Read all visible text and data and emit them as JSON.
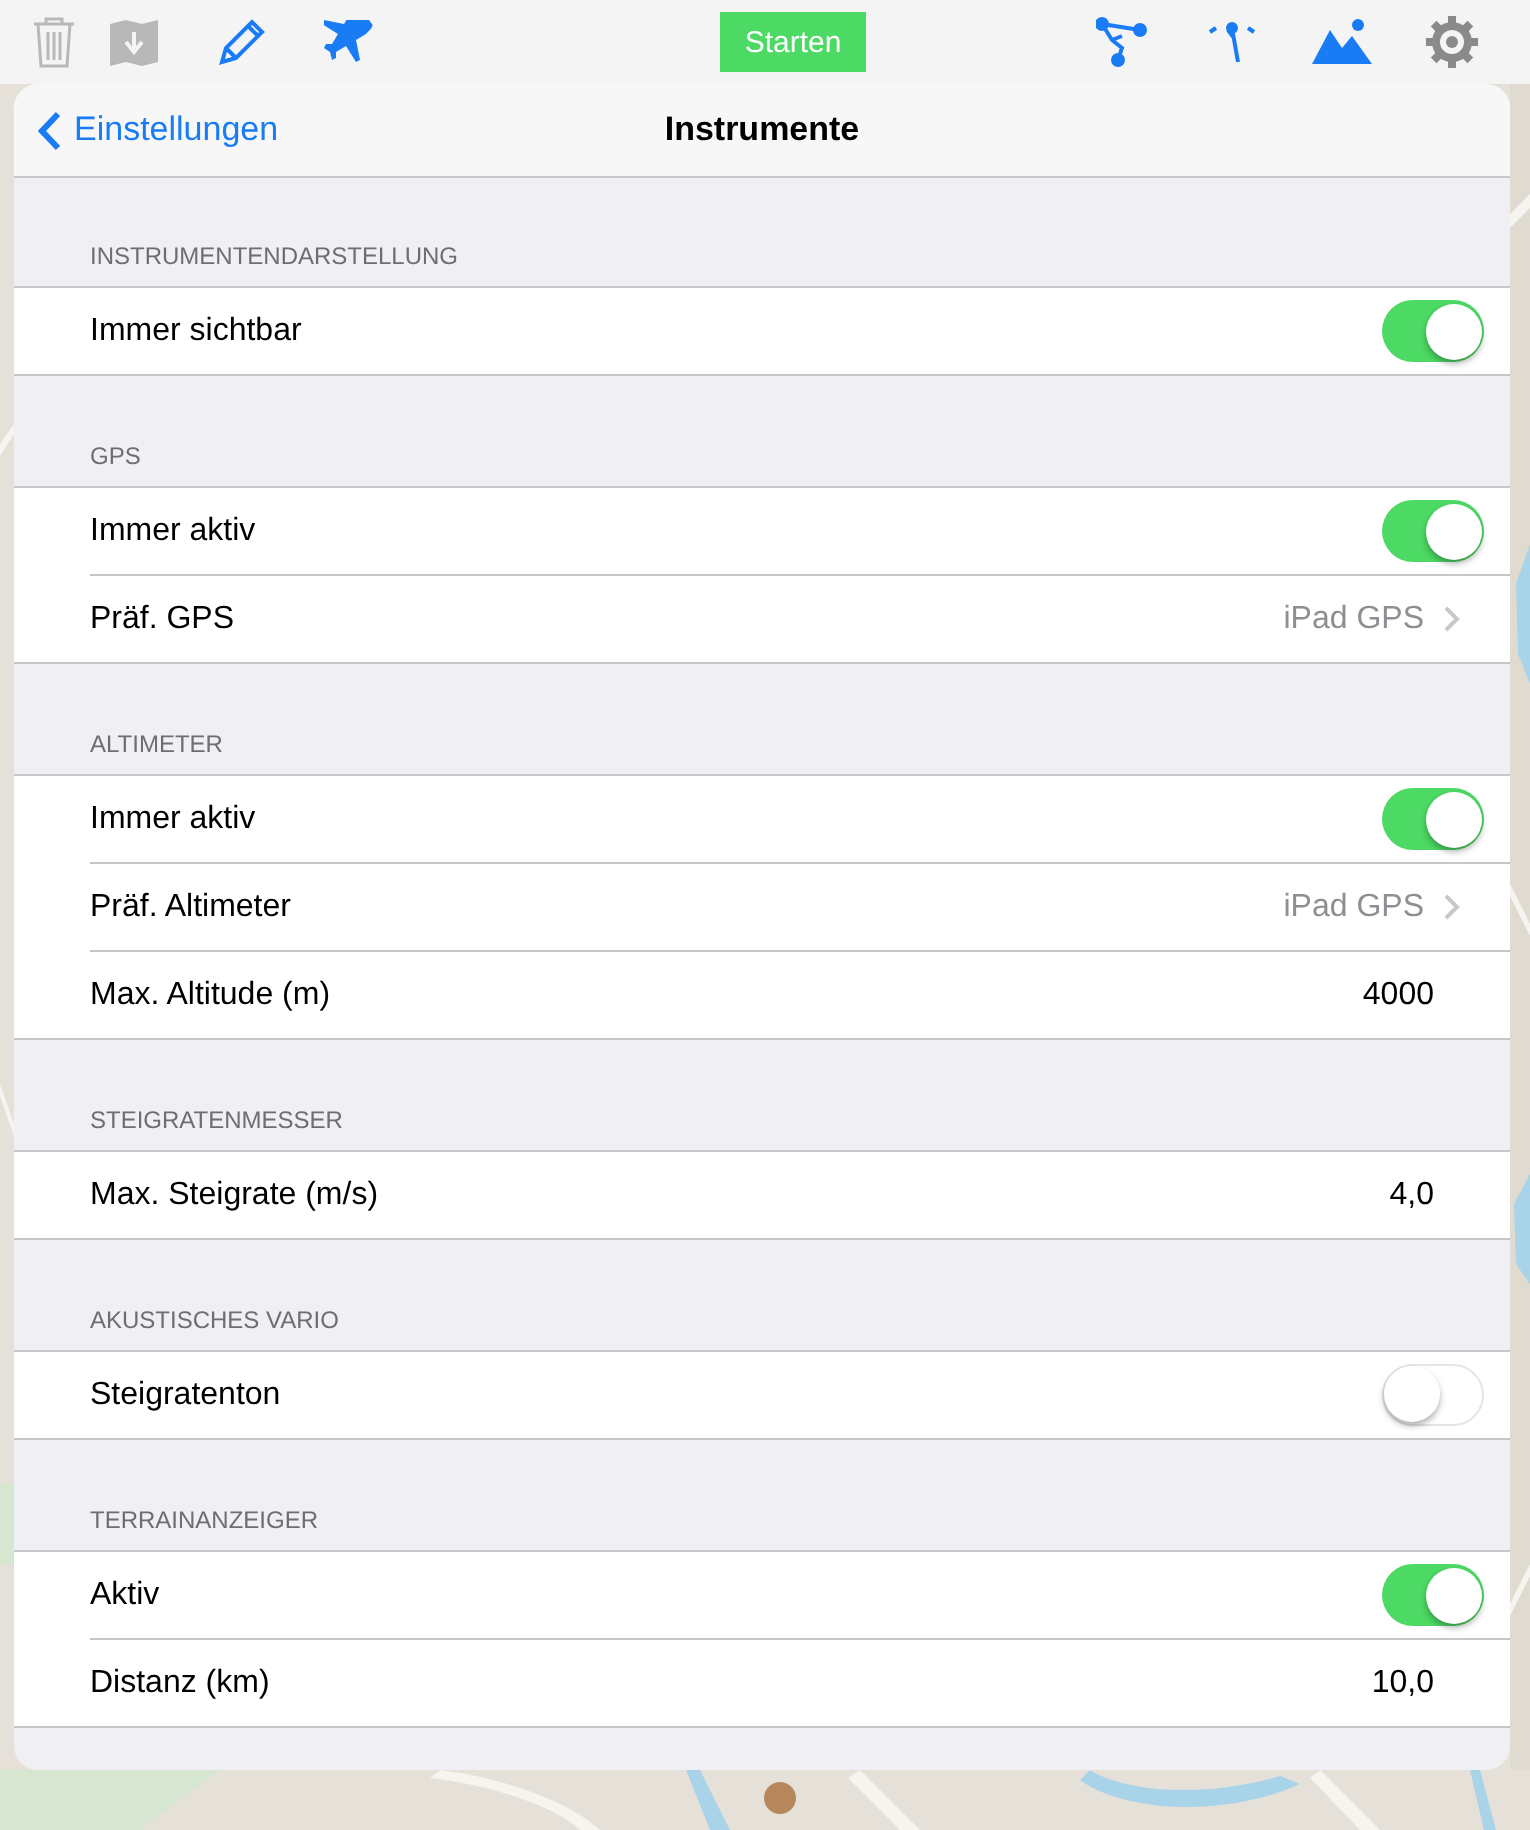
{
  "toolbar": {
    "left": [
      {
        "kind": "trash",
        "disabled": true
      },
      {
        "kind": "folder",
        "disabled": true
      },
      {
        "kind": "pencil",
        "disabled": false
      },
      {
        "kind": "airplane",
        "disabled": false
      }
    ],
    "start_button": "Starten",
    "right": [
      {
        "kind": "route",
        "disabled": false
      },
      {
        "kind": "pointer",
        "disabled": false
      },
      {
        "kind": "mountain",
        "disabled": false
      },
      {
        "kind": "gear",
        "disabled": false
      }
    ]
  },
  "nav": {
    "back": "Einstellungen",
    "title": "Instrumente"
  },
  "sections": [
    {
      "header": "INSTRUMENTENDARSTELLUNG",
      "rows": [
        {
          "kind": "toggle",
          "label": "Immer sichtbar",
          "on": true
        }
      ]
    },
    {
      "header": "GPS",
      "rows": [
        {
          "kind": "toggle",
          "label": "Immer aktiv",
          "on": true
        },
        {
          "kind": "link",
          "label": "Präf. GPS",
          "value": "iPad GPS"
        }
      ]
    },
    {
      "header": "ALTIMETER",
      "rows": [
        {
          "kind": "toggle",
          "label": "Immer aktiv",
          "on": true
        },
        {
          "kind": "link",
          "label": "Präf. Altimeter",
          "value": "iPad GPS"
        },
        {
          "kind": "value",
          "label": "Max. Altitude (m)",
          "value": "4000"
        }
      ]
    },
    {
      "header": "STEIGRATENMESSER",
      "rows": [
        {
          "kind": "value",
          "label": "Max. Steigrate (m/s)",
          "value": "4,0"
        }
      ]
    },
    {
      "header": "AKUSTISCHES VARIO",
      "rows": [
        {
          "kind": "toggle",
          "label": "Steigratenton",
          "on": false
        }
      ]
    },
    {
      "header": "TERRAINANZEIGER",
      "rows": [
        {
          "kind": "toggle",
          "label": "Aktiv",
          "on": true
        },
        {
          "kind": "value",
          "label": "Distanz (km)",
          "value": "10,0"
        }
      ]
    }
  ]
}
